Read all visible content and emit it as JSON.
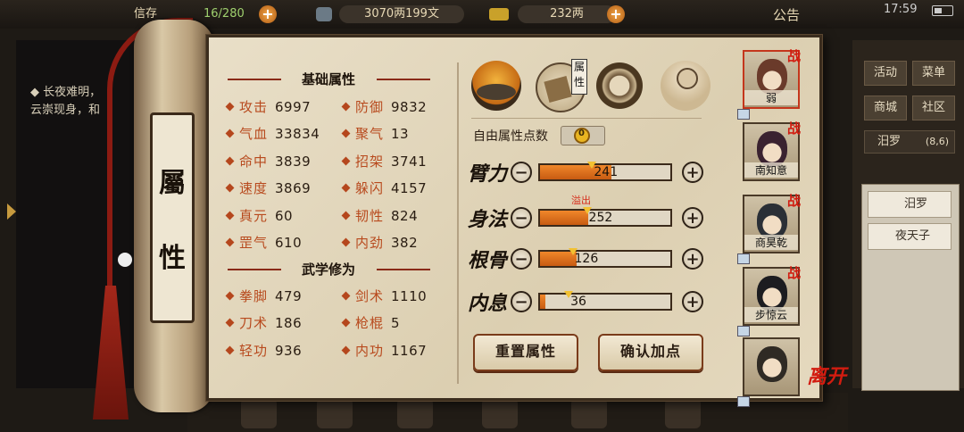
{
  "topbar": {
    "slots_label": "信存",
    "slots": "16/280",
    "money": "3070两199文",
    "gold": "232两",
    "notice": "公告",
    "time": "17:59"
  },
  "left_pane": {
    "line1": "长夜难明，",
    "line2": "云崇现身，和"
  },
  "right_pane": {
    "btn_activity": "活动",
    "btn_menu": "菜单",
    "btn_shop": "商城",
    "btn_community": "社区",
    "location": "汨罗",
    "coords": "(8,6)",
    "list": [
      "汨罗",
      "夜天子"
    ]
  },
  "scroll": {
    "title_top": "屬",
    "title_bottom": "性"
  },
  "basic": {
    "header": "基础属性",
    "stats": [
      {
        "label": "攻击",
        "value": "6997"
      },
      {
        "label": "防御",
        "value": "9832"
      },
      {
        "label": "气血",
        "value": "33834"
      },
      {
        "label": "聚气",
        "value": "13"
      },
      {
        "label": "命中",
        "value": "3839"
      },
      {
        "label": "招架",
        "value": "3741"
      },
      {
        "label": "速度",
        "value": "3869"
      },
      {
        "label": "躲闪",
        "value": "4157"
      },
      {
        "label": "真元",
        "value": "60"
      },
      {
        "label": "韧性",
        "value": "824"
      },
      {
        "label": "罡气",
        "value": "610"
      },
      {
        "label": "内劲",
        "value": "382"
      }
    ]
  },
  "martial": {
    "header": "武学修为",
    "stats": [
      {
        "label": "拳脚",
        "value": "479"
      },
      {
        "label": "剑术",
        "value": "1110"
      },
      {
        "label": "刀术",
        "value": "186"
      },
      {
        "label": "枪棍",
        "value": "5"
      },
      {
        "label": "轻功",
        "value": "936"
      },
      {
        "label": "内功",
        "value": "1167"
      }
    ]
  },
  "tabs": {
    "attributes_tag": "属性"
  },
  "free_points": {
    "label": "自由属性点数",
    "value": "0"
  },
  "attributes": [
    {
      "name": "臂力",
      "value": "241",
      "fill": 0.55,
      "marker": 0.4
    },
    {
      "name": "身法",
      "value": "252",
      "fill": 0.37,
      "marker": 0.36,
      "note": "溢出"
    },
    {
      "name": "根骨",
      "value": "126",
      "fill": 0.28,
      "marker": 0.25
    },
    {
      "name": "内息",
      "value": "36",
      "fill": 0.04,
      "marker": 0.22
    }
  ],
  "buttons": {
    "reset": "重置属性",
    "confirm": "确认加点"
  },
  "party": {
    "war_tag": "战",
    "members": [
      "弱",
      "南知意",
      "商昊乾",
      "步惊云",
      ""
    ],
    "leave": "离开"
  },
  "colors": {
    "accent_red": "#b84a1e",
    "bar_orange": "#e07421",
    "paper": "#e2d6bb"
  }
}
